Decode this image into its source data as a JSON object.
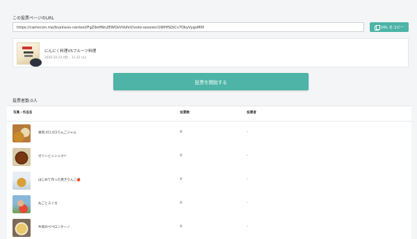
{
  "vote_page": {
    "section_label": "この投票ページのURL",
    "url": "https://camecon.me/business-contest/FgZ9sHNn2EWOsVVofxV/vote-session/1WHfSDiCv7OkyVygsM0f",
    "copy_button": "URL をコピー"
  },
  "contest": {
    "title": "にんにく料理VSフルーツ料理",
    "dates": "2020.10.23 (金) - 11.22 (火)"
  },
  "start_button": "投票を開始する",
  "voters_count": "投票者数:0人",
  "table": {
    "headers": {
      "name": "写真・作品名",
      "votes": "投票数",
      "voters": "投票者"
    },
    "rows": [
      {
        "name": "果肉ゴロゴロりんごジャム",
        "votes": "0",
        "voters": "-"
      },
      {
        "name": "ガツンとニンニク!!",
        "votes": "0",
        "voters": "-"
      },
      {
        "name": "はじめて作った焼きりんご🍎",
        "votes": "0",
        "voters": "-"
      },
      {
        "name": "丸ごとスイカ",
        "votes": "0",
        "voters": "-"
      },
      {
        "name": "牛肉のペペロンチーノ",
        "votes": "0",
        "voters": "-"
      }
    ]
  },
  "colors": {
    "accent": "#4db4a7",
    "background": "#f4f5f6"
  },
  "icons": {
    "copy": "copy-icon"
  }
}
